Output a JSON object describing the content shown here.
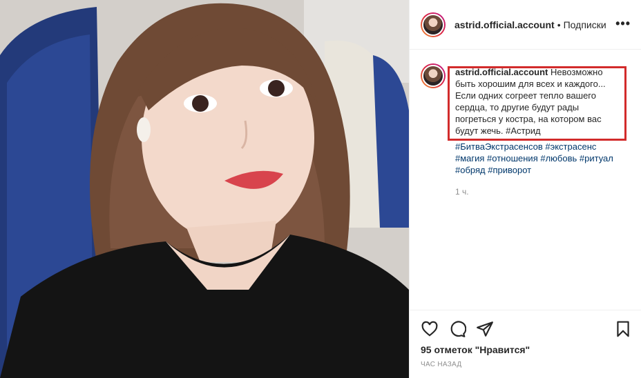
{
  "post": {
    "username": "astrid.official.account",
    "separator": "•",
    "follow_label": "Подписки",
    "more_icon": "more-horizontal-icon",
    "caption_text": "Невозможно быть хорошим для всех и каждого... Если одних согреет тепло вашего сердца, то другие будут рады погреться у костра, на котором вас будут жечь. #Астрид",
    "hashtags": "#БитваЭкстрасенсов #экстрасенс #магия #отношения #любовь #ритуал #обряд #приворот",
    "comment_time": "1 ч.",
    "likes": "95 отметок \"Нравится\"",
    "posted_ago": "ЧАС НАЗАД"
  },
  "icons": {
    "like": "heart-icon",
    "comment": "comment-icon",
    "share": "paper-plane-icon",
    "save": "bookmark-icon"
  },
  "colors": {
    "highlight_border": "#d22b2b",
    "hashtag": "#00376b",
    "muted": "#8e8e8e"
  }
}
